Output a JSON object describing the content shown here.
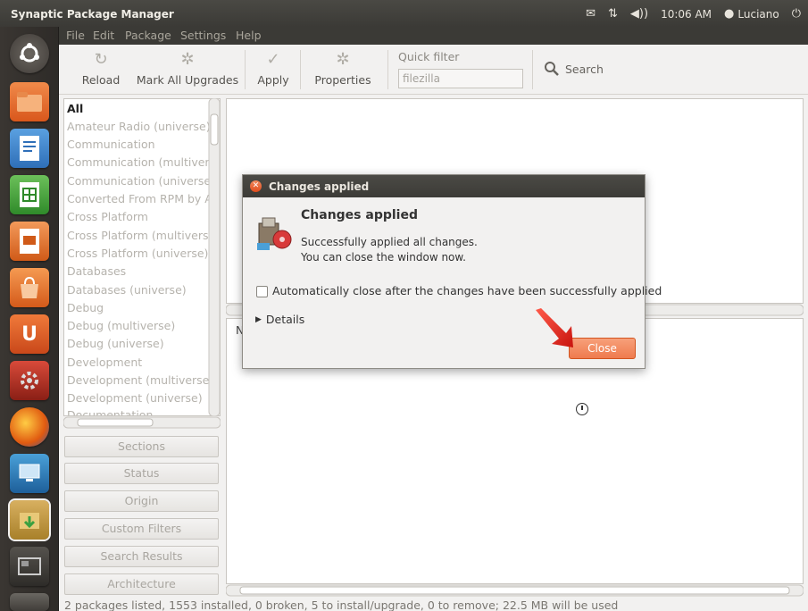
{
  "window": {
    "title": "Synaptic Package Manager"
  },
  "menu": [
    "File",
    "Edit",
    "Package",
    "Settings",
    "Help"
  ],
  "indicators": {
    "time": "10:06 AM",
    "user": "Luciano"
  },
  "launcher": [
    "ubuntu-logo",
    "files",
    "writer",
    "calc",
    "impress",
    "software-center",
    "ubuntu-one",
    "system-settings",
    "firefox",
    "remote-desktop",
    "synaptic",
    "workspace-switcher",
    "trash"
  ],
  "toolbar": {
    "reload": "Reload",
    "mark_all": "Mark All Upgrades",
    "apply": "Apply",
    "properties": "Properties",
    "quick_filter_label": "Quick filter",
    "quick_filter_value": "filezilla",
    "search": "Search"
  },
  "categories": [
    "All",
    "Amateur Radio (universe)",
    "Communication",
    "Communication (multivers",
    "Communication (universe)",
    "Converted From RPM by Al",
    "Cross Platform",
    "Cross Platform (multiverse",
    "Cross Platform (universe)",
    "Databases",
    "Databases (universe)",
    "Debug",
    "Debug (multiverse)",
    "Debug (universe)",
    "Development",
    "Development (multiverse)",
    "Development (universe)",
    "Documentation"
  ],
  "filters": [
    "Sections",
    "Status",
    "Origin",
    "Custom Filters",
    "Search Results",
    "Architecture"
  ],
  "details_partial": "N",
  "status": "2 packages listed, 1553 installed, 0 broken, 5 to install/upgrade, 0 to remove; 22.5 MB will be used",
  "dialog": {
    "title": "Changes applied",
    "heading": "Changes applied",
    "message_line1": "Successfully applied all changes.",
    "message_line2": "You can close the window now.",
    "checkbox_label": "Automatically close after the changes have been successfully applied",
    "details_label": "Details",
    "close_button": "Close"
  },
  "colors": {
    "accent": "#ef7b4e",
    "panel": "#3c3b37",
    "arrow": "#e8231e"
  }
}
